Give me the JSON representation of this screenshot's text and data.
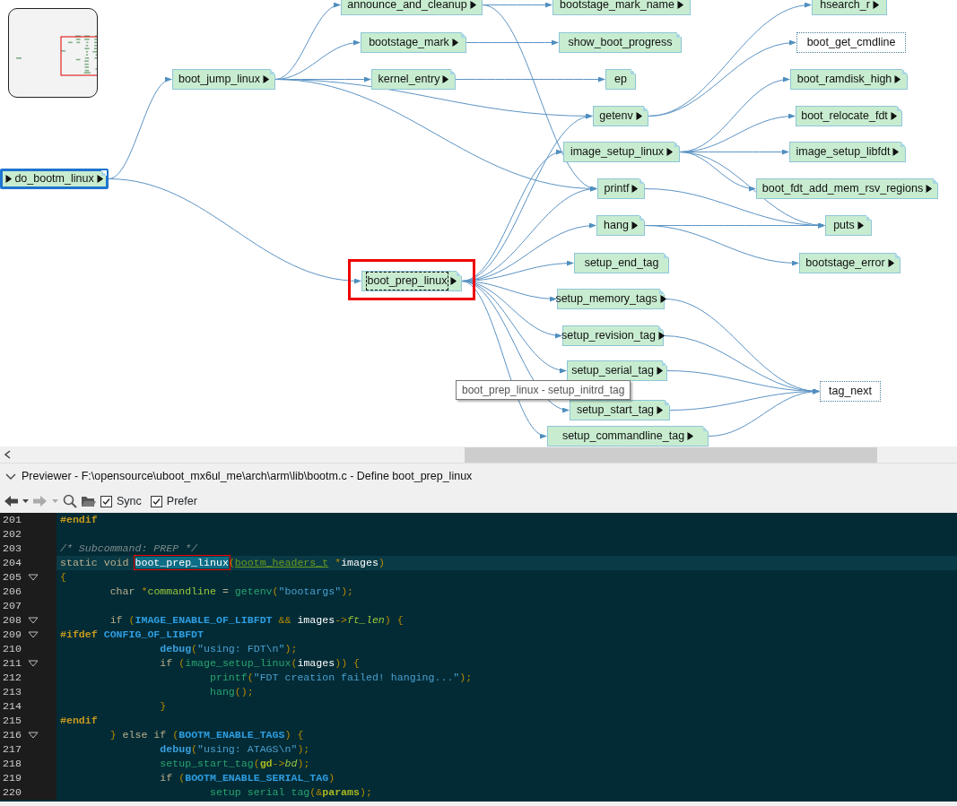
{
  "call_graph": {
    "nodes": [
      {
        "label": "do_bootm_linux",
        "kind": "defined",
        "selected": true,
        "focused": false,
        "callers_marker": true,
        "expandable": true
      },
      {
        "label": "boot_jump_linux",
        "kind": "defined",
        "selected": false,
        "focused": false,
        "callers_marker": false,
        "expandable": true
      },
      {
        "label": "announce_and_cleanup",
        "kind": "defined",
        "selected": false,
        "focused": false,
        "callers_marker": false,
        "expandable": true
      },
      {
        "label": "bootstage_mark",
        "kind": "defined",
        "selected": false,
        "focused": false,
        "callers_marker": false,
        "expandable": true
      },
      {
        "label": "kernel_entry",
        "kind": "defined",
        "selected": false,
        "focused": false,
        "callers_marker": false,
        "expandable": true
      },
      {
        "label": "bootstage_mark_name",
        "kind": "defined",
        "selected": false,
        "focused": false,
        "callers_marker": false,
        "expandable": true
      },
      {
        "label": "show_boot_progress",
        "kind": "defined",
        "selected": false,
        "focused": false,
        "callers_marker": false,
        "expandable": false
      },
      {
        "label": "ep",
        "kind": "defined",
        "selected": false,
        "focused": false,
        "callers_marker": false,
        "expandable": false
      },
      {
        "label": "getenv",
        "kind": "defined",
        "selected": false,
        "focused": false,
        "callers_marker": false,
        "expandable": true
      },
      {
        "label": "image_setup_linux",
        "kind": "defined",
        "selected": false,
        "focused": false,
        "callers_marker": false,
        "expandable": true
      },
      {
        "label": "printf",
        "kind": "defined",
        "selected": false,
        "focused": false,
        "callers_marker": false,
        "expandable": true
      },
      {
        "label": "hang",
        "kind": "defined",
        "selected": false,
        "focused": false,
        "callers_marker": false,
        "expandable": true
      },
      {
        "label": "hsearch_r",
        "kind": "defined",
        "selected": false,
        "focused": false,
        "callers_marker": false,
        "expandable": true
      },
      {
        "label": "boot_get_cmdline",
        "kind": "undefined",
        "selected": false,
        "focused": false,
        "callers_marker": false,
        "expandable": false
      },
      {
        "label": "boot_ramdisk_high",
        "kind": "defined",
        "selected": false,
        "focused": false,
        "callers_marker": false,
        "expandable": true
      },
      {
        "label": "boot_relocate_fdt",
        "kind": "defined",
        "selected": false,
        "focused": false,
        "callers_marker": false,
        "expandable": true
      },
      {
        "label": "image_setup_libfdt",
        "kind": "defined",
        "selected": false,
        "focused": false,
        "callers_marker": false,
        "expandable": true
      },
      {
        "label": "boot_fdt_add_mem_rsv_regions",
        "kind": "defined",
        "selected": false,
        "focused": false,
        "callers_marker": false,
        "expandable": true
      },
      {
        "label": "puts",
        "kind": "defined",
        "selected": false,
        "focused": false,
        "callers_marker": false,
        "expandable": true
      },
      {
        "label": "bootstage_error",
        "kind": "defined",
        "selected": false,
        "focused": false,
        "callers_marker": false,
        "expandable": true
      },
      {
        "label": "boot_prep_linux",
        "kind": "defined",
        "selected": false,
        "focused": true,
        "callers_marker": false,
        "expandable": true
      },
      {
        "label": "setup_end_tag",
        "kind": "defined",
        "selected": false,
        "focused": false,
        "callers_marker": false,
        "expandable": false
      },
      {
        "label": "setup_memory_tags",
        "kind": "defined",
        "selected": false,
        "focused": false,
        "callers_marker": false,
        "expandable": true
      },
      {
        "label": "setup_revision_tag",
        "kind": "defined",
        "selected": false,
        "focused": false,
        "callers_marker": false,
        "expandable": true
      },
      {
        "label": "setup_serial_tag",
        "kind": "defined",
        "selected": false,
        "focused": false,
        "callers_marker": false,
        "expandable": true
      },
      {
        "label": "setup_start_tag",
        "kind": "defined",
        "selected": false,
        "focused": false,
        "callers_marker": false,
        "expandable": true
      },
      {
        "label": "setup_commandline_tag",
        "kind": "defined",
        "selected": false,
        "focused": false,
        "callers_marker": false,
        "expandable": true
      },
      {
        "label": "tag_next",
        "kind": "undefined",
        "selected": false,
        "focused": false,
        "callers_marker": false,
        "expandable": false
      }
    ],
    "tooltip": "boot_prep_linux - setup_initrd_tag"
  },
  "previewer": {
    "title": "Previewer - F:\\opensource\\uboot_mx6ul_me\\arch\\arm\\lib\\bootm.c - Define boot_prep_linux",
    "toolbar": {
      "back_disabled": false,
      "forward_disabled": true,
      "checkboxes": [
        {
          "label": "Sync",
          "checked": true
        },
        {
          "label": "Prefer",
          "checked": true
        }
      ]
    },
    "lines": [
      {
        "number": "201",
        "fold": false,
        "current": false,
        "tokens": [
          {
            "kind": "preproc",
            "text": "#endif"
          }
        ]
      },
      {
        "number": "202",
        "fold": false,
        "current": false
      },
      {
        "number": "203",
        "fold": false,
        "current": false,
        "tokens": [
          {
            "kind": "comment",
            "text": "/* Subcommand: PREP */"
          }
        ]
      },
      {
        "number": "204",
        "fold": false,
        "current": true,
        "tokens": [
          {
            "kind": "keyword",
            "text": "static void "
          },
          {
            "kind": "selection",
            "text": "boot_prep_linux"
          },
          {
            "kind": "punct",
            "text": "("
          },
          {
            "kind": "type",
            "text": "bootm_headers_t"
          },
          {
            "kind": "punct",
            "text": " *"
          },
          {
            "kind": "ident",
            "text": "images"
          },
          {
            "kind": "punct",
            "text": ")"
          }
        ]
      },
      {
        "number": "205",
        "fold": true,
        "current": false,
        "tokens": [
          {
            "kind": "punct",
            "text": "{"
          }
        ]
      },
      {
        "number": "206",
        "fold": false,
        "current": false,
        "tokens": [
          {
            "kind": "keyword",
            "text": "        char "
          },
          {
            "kind": "punct",
            "text": "*"
          },
          {
            "kind": "local",
            "text": "commandline"
          },
          {
            "kind": "keyword",
            "text": " = "
          },
          {
            "kind": "func",
            "text": "getenv"
          },
          {
            "kind": "punct",
            "text": "("
          },
          {
            "kind": "string",
            "text": "\"bootargs\""
          },
          {
            "kind": "punct",
            "text": ");"
          }
        ]
      },
      {
        "number": "207",
        "fold": false,
        "current": false
      },
      {
        "number": "208",
        "fold": true,
        "current": false,
        "tokens": [
          {
            "kind": "keyword",
            "text": "        if "
          },
          {
            "kind": "punct",
            "text": "("
          },
          {
            "kind": "macro",
            "text": "IMAGE_ENABLE_OF_LIBFDT"
          },
          {
            "kind": "punct",
            "text": " && "
          },
          {
            "kind": "ident",
            "text": "images"
          },
          {
            "kind": "punct",
            "text": "->"
          },
          {
            "kind": "member",
            "text": "ft_len"
          },
          {
            "kind": "punct",
            "text": ") {"
          }
        ]
      },
      {
        "number": "209",
        "fold": true,
        "current": false,
        "tokens": [
          {
            "kind": "preproc",
            "text": "#ifdef "
          },
          {
            "kind": "macro",
            "text": "CONFIG_OF_LIBFDT"
          }
        ]
      },
      {
        "number": "210",
        "fold": false,
        "current": false,
        "tokens": [
          {
            "kind": "macrofunc",
            "text": "                debug"
          },
          {
            "kind": "punct",
            "text": "("
          },
          {
            "kind": "string",
            "text": "\"using: FDT\\n\""
          },
          {
            "kind": "punct",
            "text": ");"
          }
        ]
      },
      {
        "number": "211",
        "fold": true,
        "current": false,
        "tokens": [
          {
            "kind": "keyword",
            "text": "                if "
          },
          {
            "kind": "punct",
            "text": "("
          },
          {
            "kind": "func",
            "text": "image_setup_linux"
          },
          {
            "kind": "punct",
            "text": "("
          },
          {
            "kind": "ident",
            "text": "images"
          },
          {
            "kind": "punct",
            "text": ")) {"
          }
        ]
      },
      {
        "number": "212",
        "fold": false,
        "current": false,
        "tokens": [
          {
            "kind": "func",
            "text": "                        printf"
          },
          {
            "kind": "punct",
            "text": "("
          },
          {
            "kind": "string",
            "text": "\"FDT creation failed! hanging...\""
          },
          {
            "kind": "punct",
            "text": ");"
          }
        ]
      },
      {
        "number": "213",
        "fold": false,
        "current": false,
        "tokens": [
          {
            "kind": "func",
            "text": "                        hang"
          },
          {
            "kind": "punct",
            "text": "();"
          }
        ]
      },
      {
        "number": "214",
        "fold": false,
        "current": false,
        "tokens": [
          {
            "kind": "punct",
            "text": "                }"
          }
        ]
      },
      {
        "number": "215",
        "fold": false,
        "current": false,
        "tokens": [
          {
            "kind": "preproc",
            "text": "#endif"
          }
        ]
      },
      {
        "number": "216",
        "fold": true,
        "current": false,
        "tokens": [
          {
            "kind": "punct",
            "text": "        } "
          },
          {
            "kind": "keyword",
            "text": "else if "
          },
          {
            "kind": "punct",
            "text": "("
          },
          {
            "kind": "macro",
            "text": "BOOTM_ENABLE_TAGS"
          },
          {
            "kind": "punct",
            "text": ") {"
          }
        ]
      },
      {
        "number": "217",
        "fold": false,
        "current": false,
        "tokens": [
          {
            "kind": "macrofunc",
            "text": "                debug"
          },
          {
            "kind": "punct",
            "text": "("
          },
          {
            "kind": "string",
            "text": "\"using: ATAGS\\n\""
          },
          {
            "kind": "punct",
            "text": ");"
          }
        ]
      },
      {
        "number": "218",
        "fold": false,
        "current": false,
        "tokens": [
          {
            "kind": "func",
            "text": "                setup_start_tag"
          },
          {
            "kind": "punct",
            "text": "("
          },
          {
            "kind": "global",
            "text": "gd"
          },
          {
            "kind": "punct",
            "text": "->"
          },
          {
            "kind": "member",
            "text": "bd"
          },
          {
            "kind": "punct",
            "text": ");"
          }
        ]
      },
      {
        "number": "219",
        "fold": false,
        "current": false,
        "tokens": [
          {
            "kind": "keyword",
            "text": "                if "
          },
          {
            "kind": "punct",
            "text": "("
          },
          {
            "kind": "macro",
            "text": "BOOTM_ENABLE_SERIAL_TAG"
          },
          {
            "kind": "punct",
            "text": ")"
          }
        ]
      },
      {
        "number": "220",
        "fold": false,
        "current": false,
        "tokens": [
          {
            "kind": "func",
            "text": "                        setup serial tag"
          },
          {
            "kind": "punct",
            "text": "(&"
          },
          {
            "kind": "global",
            "text": "params"
          },
          {
            "kind": "punct",
            "text": ");"
          }
        ]
      }
    ]
  }
}
